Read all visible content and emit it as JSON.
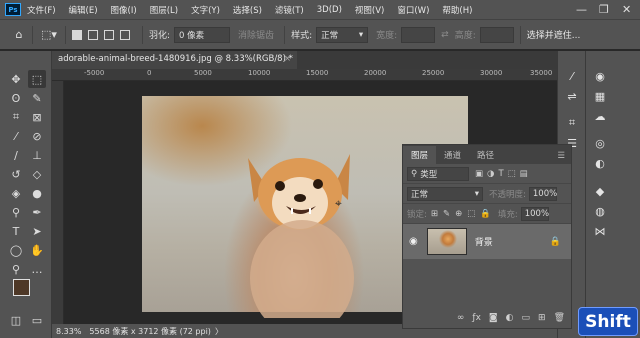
{
  "app": {
    "logo": "Ps"
  },
  "menu": [
    "文件(F)",
    "编辑(E)",
    "图像(I)",
    "图层(L)",
    "文字(Y)",
    "选择(S)",
    "滤镜(T)",
    "3D(D)",
    "视图(V)",
    "窗口(W)",
    "帮助(H)"
  ],
  "window_controls": {
    "minimize": "—",
    "restore": "❐",
    "close": "✕"
  },
  "options": {
    "feather_label": "羽化:",
    "feather_value": "0 像素",
    "antialias_label": "消除锯齿",
    "style_label": "样式:",
    "style_value": "正常",
    "width_label": "宽度:",
    "height_label": "高度:",
    "select_mask_button": "选择并遮住..."
  },
  "document": {
    "tab_title": "adorable-animal-breed-1480916.jpg @ 8.33%(RGB/8) *",
    "close_glyph": "×"
  },
  "ruler_labels": [
    "-5000",
    "0",
    "5000",
    "10000",
    "15000",
    "20000",
    "25000",
    "30000",
    "35000",
    "40000"
  ],
  "status": {
    "zoom": "8.33%",
    "info": "5568 像素 x 3712 像素 (72 ppi)",
    "arrow": "〉"
  },
  "layers_panel": {
    "tabs": [
      "图层",
      "通道",
      "路径"
    ],
    "active_tab": 0,
    "filter_label": "类型",
    "blend_mode": "正常",
    "opacity_label": "不透明度:",
    "opacity_value": "100%",
    "lock_label": "锁定:",
    "fill_label": "填充:",
    "fill_value": "100%",
    "layer_name": "背景"
  },
  "overlay": {
    "shift_label": "Shift"
  },
  "colors": {
    "panel_bg": "#535353",
    "workspace_bg": "#282828",
    "accent_blue": "#31a8ff",
    "foreground_swatch": "#4e3827",
    "background_swatch": "#ffffff",
    "shift_badge": "#1b4fb8"
  },
  "icons": {
    "toolbar": [
      "move-icon",
      "marquee-icon",
      "lasso-icon",
      "quick-select-icon",
      "crop-icon",
      "frame-icon",
      "eyedropper-icon",
      "healing-brush-icon",
      "brush-icon",
      "clone-stamp-icon",
      "history-brush-icon",
      "eraser-icon",
      "paint-bucket-icon",
      "blur-icon",
      "dodge-icon",
      "pen-icon",
      "type-icon",
      "path-select-icon",
      "rectangle-icon",
      "hand-icon",
      "zoom-icon",
      "more-icon",
      "quick-mask-icon",
      "screen-mode-icon"
    ]
  }
}
